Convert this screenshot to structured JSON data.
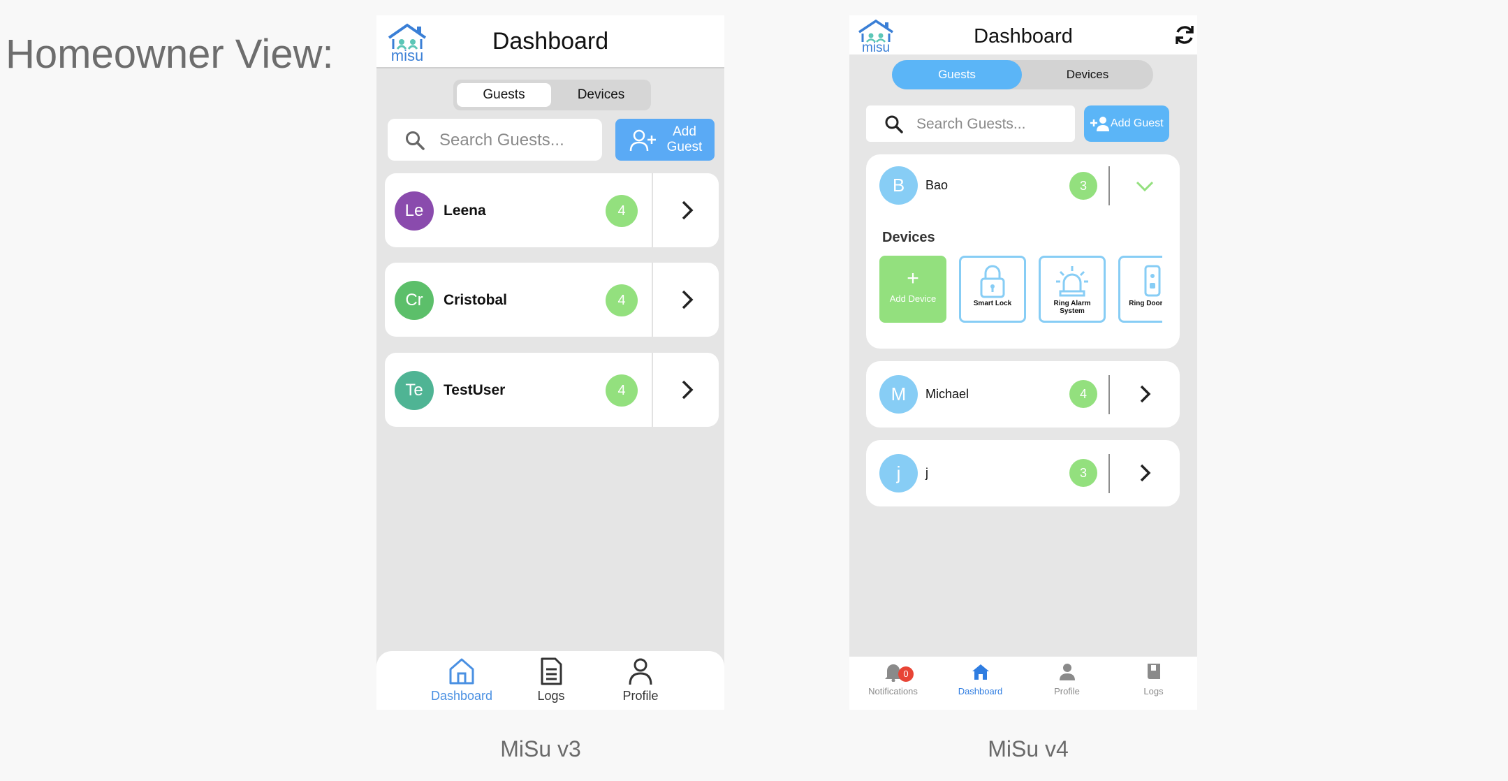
{
  "heading": "Homeowner View:",
  "colors": {
    "accent_v3": "#5aaaf5",
    "accent_v4": "#5bb5f7",
    "badge": "#93e07e",
    "nav_active": "#2f7de1",
    "notif": "#e84435"
  },
  "v3": {
    "caption": "MiSu v3",
    "logo_text": "misu",
    "title": "Dashboard",
    "tabs": [
      {
        "label": "Guests",
        "active": true
      },
      {
        "label": "Devices",
        "active": false
      }
    ],
    "search_placeholder": "Search Guests...",
    "add_label": "Add Guest",
    "guests": [
      {
        "initials": "Le",
        "name": "Leena",
        "count": "4",
        "color": "#8a4bad"
      },
      {
        "initials": "Cr",
        "name": "Cristobal",
        "count": "4",
        "color": "#5cbf6a"
      },
      {
        "initials": "Te",
        "name": "TestUser",
        "count": "4",
        "color": "#4fb494"
      }
    ],
    "nav": [
      {
        "label": "Dashboard",
        "icon": "home-icon",
        "active": true
      },
      {
        "label": "Logs",
        "icon": "document-icon",
        "active": false
      },
      {
        "label": "Profile",
        "icon": "user-icon",
        "active": false
      }
    ]
  },
  "v4": {
    "caption": "MiSu v4",
    "logo_text": "misu",
    "title": "Dashboard",
    "tabs": [
      {
        "label": "Guests",
        "active": true
      },
      {
        "label": "Devices",
        "active": false
      }
    ],
    "search_placeholder": "Search Guests...",
    "add_label": "Add Guest",
    "expanded_guest": {
      "initial": "B",
      "name": "Bao",
      "count": "3",
      "devices_title": "Devices",
      "add_device_label": "Add Device",
      "devices": [
        {
          "label": "Smart Lock",
          "icon": "lock-icon"
        },
        {
          "label": "Ring Alarm System",
          "icon": "alarm-icon"
        },
        {
          "label": "Ring Doorbell",
          "icon": "doorbell-icon"
        }
      ]
    },
    "guests": [
      {
        "initial": "M",
        "name": "Michael",
        "count": "4"
      },
      {
        "initial": "j",
        "name": "j",
        "count": "3"
      }
    ],
    "nav": [
      {
        "label": "Notifications",
        "icon": "bell-icon",
        "badge": "0",
        "active": false
      },
      {
        "label": "Dashboard",
        "icon": "home-icon",
        "active": true
      },
      {
        "label": "Profile",
        "icon": "user-icon",
        "active": false
      },
      {
        "label": "Logs",
        "icon": "book-icon",
        "active": false
      }
    ]
  }
}
